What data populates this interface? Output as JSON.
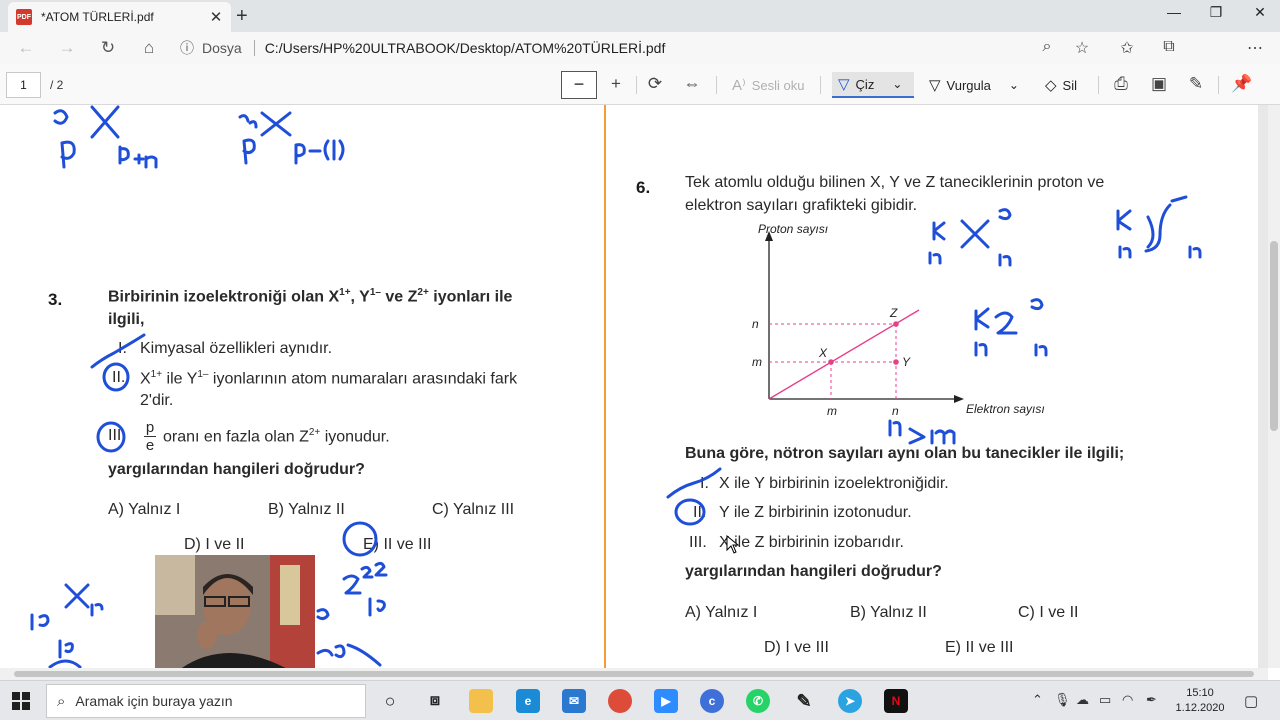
{
  "browser": {
    "tab_title": "*ATOM TÜRLERİ.pdf",
    "tab_icon": "pdf-icon",
    "address_label": "Dosya",
    "url": "C:/Users/HP%20ULTRABOOK/Desktop/ATOM%20TÜRLERİ.pdf"
  },
  "pdf_toolbar": {
    "page_current": "1",
    "page_total": "/ 2",
    "read_aloud": "Sesli oku",
    "draw": "Çiz",
    "highlight": "Vurgula",
    "erase": "Sil"
  },
  "question3": {
    "number": "3.",
    "stem_a": "Birbirinin izoelektroniği olan X",
    "x_charge": "1+",
    "stem_b": ", Y",
    "y_charge": "1–",
    "stem_c": " ve Z",
    "z_charge": "2+",
    "stem_d": " iyonları ile",
    "stem_line2": "ilgili,",
    "s1_num": "I.",
    "s1": "Kimyasal özellikleri aynıdır.",
    "s2_num": "II.",
    "s2_a": "X",
    "s2_a_sup": "1+",
    "s2_b": " ile Y",
    "s2_b_sup": "1–",
    "s2_c": " iyonlarının atom numaraları arasındaki fark",
    "s2_line2": "2'dir.",
    "s3_num": "III.",
    "s3_frac_top": "p",
    "s3_frac_bottom": "e",
    "s3_a": "oranı en fazla olan Z",
    "s3_sup": "2+",
    "s3_b": " iyonudur.",
    "ask": "yargılarından hangileri doğrudur?",
    "options": [
      "A)  Yalnız I",
      "B)  Yalnız II",
      "C)  Yalnız III",
      "D)  I ve II",
      "E)  II ve III"
    ]
  },
  "question6": {
    "number": "6.",
    "stem_line1": "Tek atomlu olduğu bilinen X, Y ve Z taneciklerinin proton ve",
    "stem_line2": "elektron sayıları grafikteki gibidir.",
    "ask_head": "Buna göre, nötron sayıları aynı olan bu tanecikler ile ilgili;",
    "s1_num": "I.",
    "s1": "X ile Y birbirinin izoelektroniğidir.",
    "s2_num": "II.",
    "s2": "Y ile Z birbirinin izotonudur.",
    "s3_num": "III.",
    "s3": "X ile Z birbirinin izobarıdır.",
    "ask": "yargılarından hangileri doğrudur?",
    "options": [
      "A)  Yalnız I",
      "B)  Yalnız II",
      "C)  I ve II",
      "D)  I ve III",
      "E)  II ve III"
    ]
  },
  "chart_data": {
    "type": "scatter",
    "ylabel": "Proton sayısı",
    "xlabel": "Elektron sayısı",
    "x_ticks": [
      "m",
      "n"
    ],
    "y_ticks": [
      "m",
      "n"
    ],
    "points": [
      {
        "label": "X",
        "x": "m",
        "y": "m"
      },
      {
        "label": "Y",
        "x": "n",
        "y": "m"
      },
      {
        "label": "Z",
        "x": "n",
        "y": "n"
      }
    ],
    "line_color": "#e6408a"
  },
  "taskbar": {
    "search_placeholder": "Aramak için buraya yazın",
    "time": "15:10",
    "date": "1.12.2020"
  }
}
